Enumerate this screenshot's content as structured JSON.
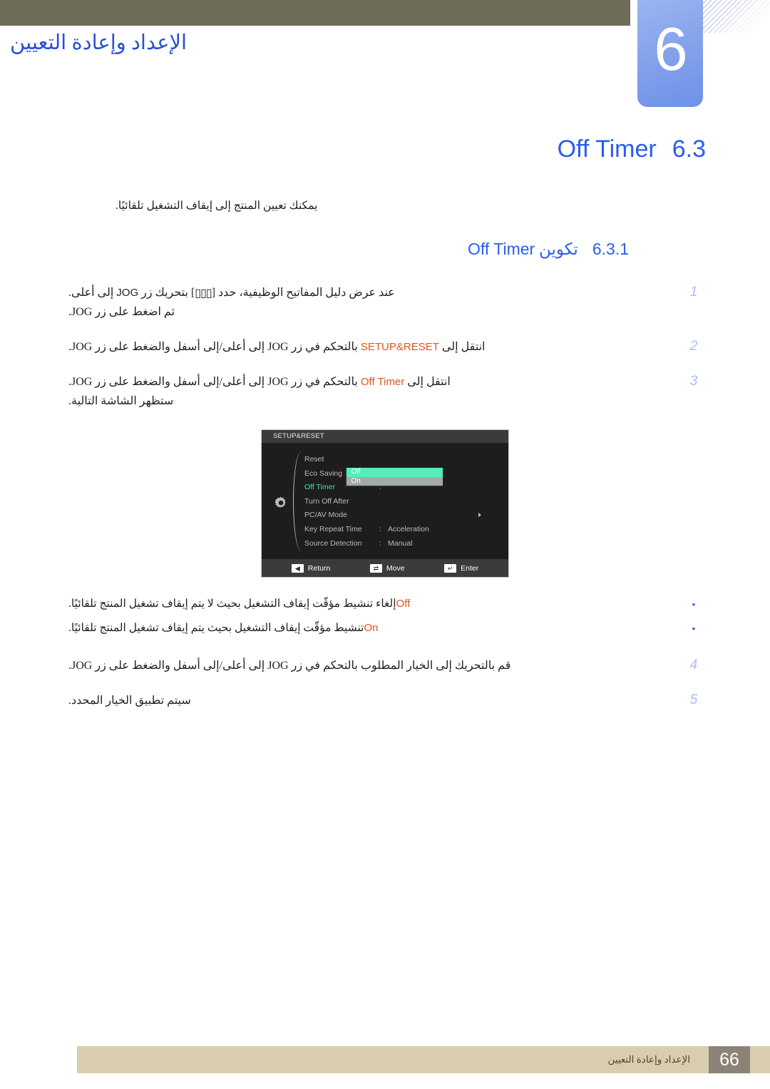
{
  "header": {
    "chapter_number": "6",
    "chapter_title": "الإعداد وإعادة التعيين"
  },
  "section": {
    "number": "6.3",
    "title": "Off Timer",
    "intro": "يمكنك تعيين المنتج إلى إيقاف التشغيل تلقائيًا."
  },
  "subsection": {
    "number": "6.3.1",
    "title_ar": "تكوين",
    "title_en": "Off Timer"
  },
  "steps": [
    {
      "number": "1",
      "line1_a": "عند عرض دليل المفاتيح الوظيفية، حدد [",
      "glyph": "▯▯▯",
      "line1_b": "] بتحريك زر ",
      "jog": "JOG",
      "line1_c": " إلى أعلى.",
      "line2": "ثم اضغط على زر JOG."
    },
    {
      "number": "2",
      "pre": "انتقل إلى ",
      "highlight": "SETUP&RESET",
      "post": " بالتحكم في زر JOG إلى أعلى/إلى أسفل والضغط على زر JOG."
    },
    {
      "number": "3",
      "pre": "انتقل إلى ",
      "highlight": "Off Timer",
      "post": " بالتحكم في زر JOG إلى أعلى/إلى أسفل والضغط على زر JOG.",
      "line2": "ستظهر الشاشة التالية."
    },
    {
      "number": "4",
      "text": "قم بالتحريك إلى الخيار المطلوب بالتحكم في زر JOG إلى أعلى/إلى أسفل والضغط على زر JOG."
    },
    {
      "number": "5",
      "text": "سيتم تطبيق الخيار المحدد."
    }
  ],
  "bullets": [
    {
      "label": "Off",
      "text": "إلغاء تنشيط مؤقّت إيقاف التشغيل بحيث لا يتم إيقاف تشغيل المنتج تلقائيًا."
    },
    {
      "label": "On",
      "text": "تنشيط مؤقّت إيقاف التشغيل بحيث يتم إيقاف تشغيل المنتج تلقائيًا."
    }
  ],
  "osd": {
    "title": "SETUP&RESET",
    "rows": [
      {
        "label": "Reset",
        "value": "",
        "colon": "",
        "active": false,
        "arrow": false
      },
      {
        "label": "Eco Saving",
        "value": "Off",
        "colon": ":",
        "active": false,
        "arrow": false
      },
      {
        "label": "Off Timer",
        "value": "",
        "colon": ":",
        "active": true,
        "arrow": false
      },
      {
        "label": "Turn Off After",
        "value": "",
        "colon": "",
        "active": false,
        "arrow": false
      },
      {
        "label": "PC/AV Mode",
        "value": "",
        "colon": "",
        "active": false,
        "arrow": true
      },
      {
        "label": "Key Repeat Time",
        "value": "Acceleration",
        "colon": ":",
        "active": false,
        "arrow": false
      },
      {
        "label": "Source Detection",
        "value": "Manual",
        "colon": ":",
        "active": false,
        "arrow": false
      }
    ],
    "popup_options": [
      {
        "label": "Off",
        "selected": true
      },
      {
        "label": "On",
        "selected": false
      }
    ],
    "footer": [
      {
        "icon": "◀",
        "label": "Return"
      },
      {
        "icon": "⇄",
        "label": "Move"
      },
      {
        "icon": "↵",
        "label": "Enter"
      }
    ]
  },
  "footer": {
    "text": "الإعداد وإعادة التعيين",
    "page": "66"
  },
  "colors": {
    "accent_blue": "#2a5cf0",
    "highlight_orange": "#e2531f",
    "header_olive": "#6d6c58",
    "chapter_blue": "#86a4ec",
    "osd_green": "#52edb9",
    "footer_tan": "#d9cdb0",
    "footer_page_gray": "#8c8275"
  }
}
